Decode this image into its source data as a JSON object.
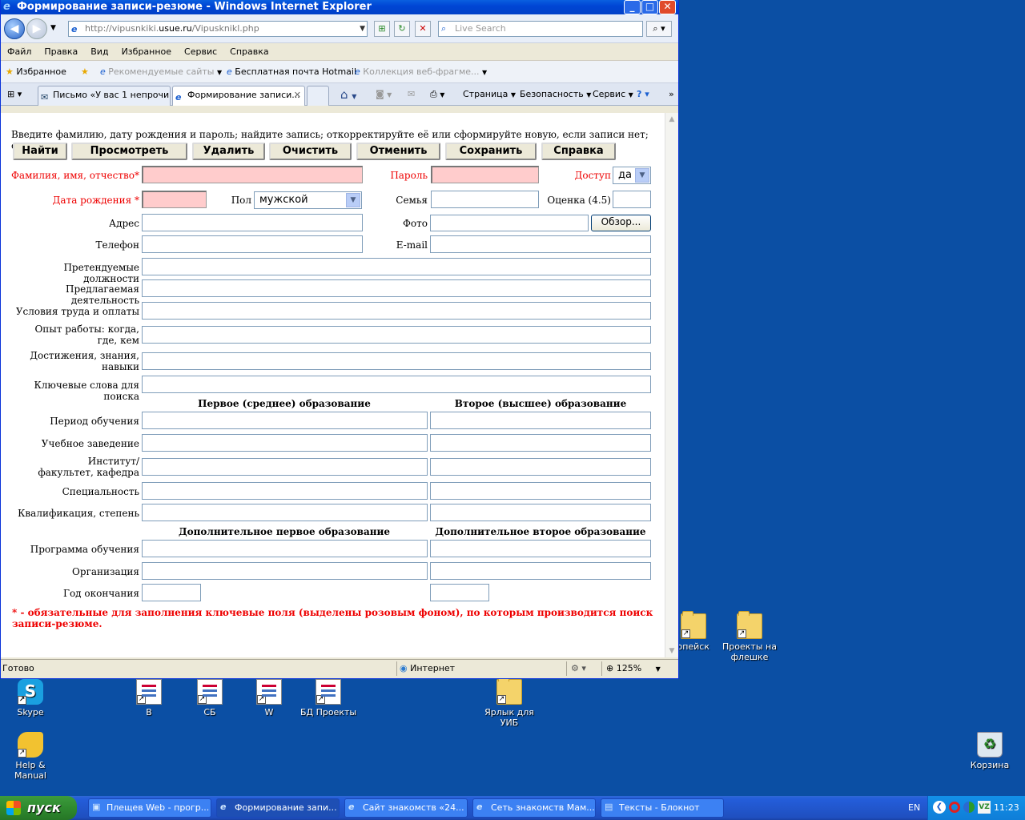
{
  "window": {
    "title": "Формирование записи-резюме - Windows Internet Explorer"
  },
  "address": {
    "url_prefix": "http://vipusnkiki.",
    "url_domain": "usue.ru",
    "url_suffix": "/Vipusknikl.php",
    "search_placeholder": "Live Search"
  },
  "menu": [
    "Файл",
    "Правка",
    "Вид",
    "Избранное",
    "Сервис",
    "Справка"
  ],
  "favorites": {
    "fav_label": "Избранное",
    "recommended": "Рекомендуемые сайты",
    "hotmail": "Бесплатная почта Hotmail",
    "webslices": "Коллекция веб-фрагме..."
  },
  "tabs": [
    {
      "label": "Письмо «У вас 1 непрочи..."
    },
    {
      "label": "Формирование записи..."
    }
  ],
  "toolbar": {
    "page": "Страница",
    "security": "Безопасность",
    "service": "Сервис"
  },
  "form": {
    "instructions": "Введите фамилию, дату рождения и пароль; найдите запись; откорректируйте её или сформируйте новую, если записи нет; сохраните.",
    "buttons": {
      "find": "Найти",
      "view": "Просмотреть",
      "delete": "Удалить",
      "clear": "Очистить",
      "cancel": "Отменить",
      "save": "Сохранить",
      "help": "Справка"
    },
    "labels": {
      "fio": "Фамилия, имя, отчество*",
      "password": "Пароль",
      "access": "Доступ",
      "birthdate": "Дата рождения *",
      "gender": "Пол",
      "family": "Семья",
      "rating": "Оценка (4.5)",
      "address": "Адрес",
      "photo": "Фото",
      "phone": "Телефон",
      "email": "E-mail",
      "positions": "Претендуемые должности",
      "activity": "Предлагаемая деятельность",
      "conditions": "Условия труда и оплаты",
      "experience": "Опыт работы: когда, где, кем",
      "achievements": "Достижения, знания, навыки",
      "keywords": "Ключевые слова для поиска",
      "study_period": "Период обучения",
      "institution": "Учебное заведение",
      "faculty": "Институт/факультет, кафедра",
      "specialty": "Специальность",
      "qualification": "Квалификация, степень",
      "program": "Программа обучения",
      "organization": "Организация",
      "grad_year": "Год окончания"
    },
    "access_value": "да",
    "gender_value": "мужской",
    "browse_button": "Обзор...",
    "section_edu1": "Первое (среднее) образование",
    "section_edu2": "Второе (высшее) образование",
    "section_add1": "Дополнительное первое образование",
    "section_add2": "Дополнительное второе образование",
    "note": "* - обязательные для заполнения ключевые поля (выделены розовым фоном), по которым производится поиск записи-резюме."
  },
  "status": {
    "ready": "Готово",
    "zone": "Интернет",
    "zoom": "125%"
  },
  "desktop": {
    "icons": [
      {
        "label": "Skype"
      },
      {
        "label": "В"
      },
      {
        "label": "СБ"
      },
      {
        "label": "W"
      },
      {
        "label": "БД Проекты"
      },
      {
        "label": "Ярлык для УИБ"
      },
      {
        "label": "Help & Manual"
      },
      {
        "label": "Корзина"
      },
      {
        "label": "опейск"
      },
      {
        "label": "Проекты на флешке"
      }
    ]
  },
  "taskbar": {
    "start": "пуск",
    "tasks": [
      {
        "label": "Плещев Web - прогр..."
      },
      {
        "label": "Формирование запи..."
      },
      {
        "label": "Сайт знакомств «24..."
      },
      {
        "label": "Сеть знакомств Мам..."
      },
      {
        "label": "Тексты - Блокнот"
      }
    ],
    "lang": "EN",
    "clock": "11:23"
  }
}
